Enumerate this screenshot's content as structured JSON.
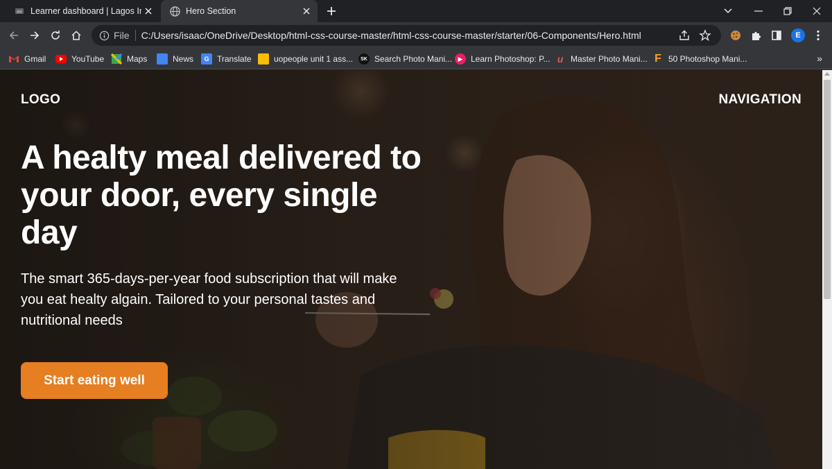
{
  "browser": {
    "tabs": [
      {
        "title": "Learner dashboard | Lagos Intran",
        "icon": "site-favicon-icon",
        "active": false
      },
      {
        "title": "Hero Section",
        "icon": "globe-icon",
        "active": true
      }
    ],
    "new_tab_label": "+",
    "omnibox": {
      "scheme_label": "File",
      "url": "C:/Users/isaac/OneDrive/Desktop/html-css-course-master/html-css-course-master/starter/06-Components/Hero.html"
    },
    "profile_initial": "E",
    "bookmarks": [
      {
        "label": "Gmail",
        "icon": "gmail-icon",
        "color": "#ea4335"
      },
      {
        "label": "YouTube",
        "icon": "youtube-icon",
        "color": "#ff0000"
      },
      {
        "label": "Maps",
        "icon": "maps-icon",
        "color": "#34a853"
      },
      {
        "label": "News",
        "icon": "news-icon",
        "color": "#4285f4"
      },
      {
        "label": "Translate",
        "icon": "translate-icon",
        "color": "#4285f4"
      },
      {
        "label": "uopeople unit 1 ass...",
        "icon": "docs-icon",
        "color": "#fbbc04"
      },
      {
        "label": "Search Photo Mani...",
        "icon": "sk-icon",
        "color": "#111111"
      },
      {
        "label": "Learn Photoshop: P...",
        "icon": "photoshop-icon",
        "color": "#e91e63"
      },
      {
        "label": "Master Photo Mani...",
        "icon": "udemy-icon",
        "color": "#ec5252"
      },
      {
        "label": "50 Photoshop Mani...",
        "icon": "f-icon",
        "color": "#f5a623"
      }
    ],
    "bookmarks_overflow": "»"
  },
  "page": {
    "logo": "LOGO",
    "navigation": "NAVIGATION",
    "headline": "A healty meal delivered to your door, every single day",
    "description": "The smart 365-days-per-year food subscription that will make you eat healty algain. Tailored to your personal tastes and nutritional needs",
    "cta_label": "Start eating well",
    "accent_color": "#e67e22"
  }
}
